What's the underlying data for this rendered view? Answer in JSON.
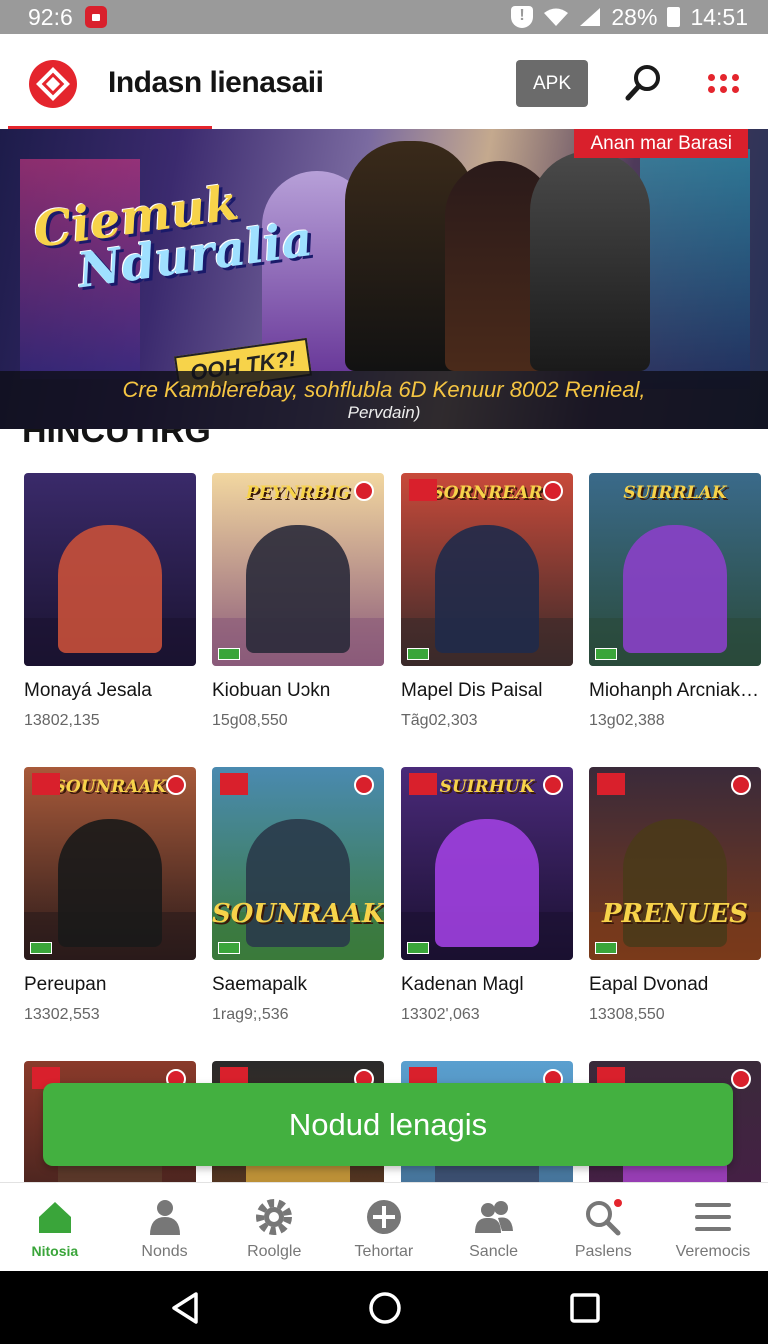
{
  "status_bar": {
    "time_left": "92:6",
    "battery": "28%",
    "time_right": "14:51"
  },
  "app_bar": {
    "title": "Indasn lienasaii",
    "apk_label": "APK",
    "icons": [
      "app-logo-icon",
      "search-icon",
      "more-grid-icon"
    ]
  },
  "banner": {
    "headline_line1": "Ciemuk",
    "headline_line2": "Nduralia",
    "badge": "OOH TK?!",
    "tag": "Anan mar Barasi",
    "caption_line1": "Cre Kamblerebay, sohflubla 6D Kenuur 8002 Renieal,",
    "caption_line2": "Pervdain)"
  },
  "section": {
    "title": "HINCUTIRG"
  },
  "games": [
    {
      "name": "Monayá Jesala",
      "count": "13802,135",
      "top": "#3a2a6a",
      "bottom": "#1a1330",
      "hero": "#c8503a",
      "logo": ""
    },
    {
      "name": "Kiobuan Uɔkn",
      "count": "15g08,550",
      "top": "#f2d7a0",
      "bottom": "#8a5a7a",
      "hero": "#2a2a3a",
      "logo": "PEYNRBIG"
    },
    {
      "name": "Mapel Dis Paisal",
      "count": "Tãg02,303",
      "top": "#c84a3a",
      "bottom": "#3a2a2a",
      "hero": "#1f2a4a",
      "logo": "SORNREAR"
    },
    {
      "name": "Miohanph Arcniaka..",
      "count": "13g02,388",
      "top": "#3a6a8a",
      "bottom": "#2a4a3a",
      "hero": "#8a40c8",
      "logo": "SUIRRLAK"
    },
    {
      "name": "Pereupan",
      "count": "13302,553",
      "top": "#a85a3a",
      "bottom": "#2a1a1a",
      "hero": "#1a1a1a",
      "logo": "SOUNRAAK"
    },
    {
      "name": "Saemapalk",
      "count": "1rag9;,536",
      "top": "#4a8ab0",
      "bottom": "#3a7a3a",
      "hero": "#2a3a4a",
      "logo": "SOUNRAAK"
    },
    {
      "name": "Kadenan Magl",
      "count": "13302',063",
      "top": "#4a2a7a",
      "bottom": "#1a1030",
      "hero": "#a040e0",
      "logo": "SUIRHUK"
    },
    {
      "name": "Eapal Dvonad",
      "count": "13308,550",
      "top": "#3a2a3a",
      "bottom": "#7a3a1a",
      "hero": "#4a3a1a",
      "logo": "PRENUES"
    },
    {
      "name": "",
      "count": "",
      "top": "#8a3a2a",
      "bottom": "#2a1a1a",
      "hero": "#5a3a2a",
      "logo": ""
    },
    {
      "name": "",
      "count": "",
      "top": "#2a2a2a",
      "bottom": "#6a3a1a",
      "hero": "#c89a3a",
      "logo": ""
    },
    {
      "name": "",
      "count": "",
      "top": "#5aa0d0",
      "bottom": "#3a5a7a",
      "hero": "#3a4a6a",
      "logo": ""
    },
    {
      "name": "",
      "count": "",
      "top": "#3a2a3a",
      "bottom": "#4a1a4a",
      "hero": "#a040c0",
      "logo": ""
    }
  ],
  "cta": {
    "label": "Nodud lenagis"
  },
  "bottom_nav": [
    {
      "label": "Nitosia",
      "icon": "home-icon",
      "active": true
    },
    {
      "label": "Nonds",
      "icon": "person-icon",
      "active": false
    },
    {
      "label": "Roolgle",
      "icon": "gear-icon",
      "active": false
    },
    {
      "label": "Tehortar",
      "icon": "plus-circle-icon",
      "active": false
    },
    {
      "label": "Sancle",
      "icon": "group-icon",
      "active": false
    },
    {
      "label": "Paslens",
      "icon": "search-icon",
      "active": false
    },
    {
      "label": "Veremocis",
      "icon": "menu-icon",
      "active": false
    }
  ],
  "colors": {
    "accent": "#e4252d",
    "cta": "#43b040",
    "active_nav": "#3aa53a"
  }
}
